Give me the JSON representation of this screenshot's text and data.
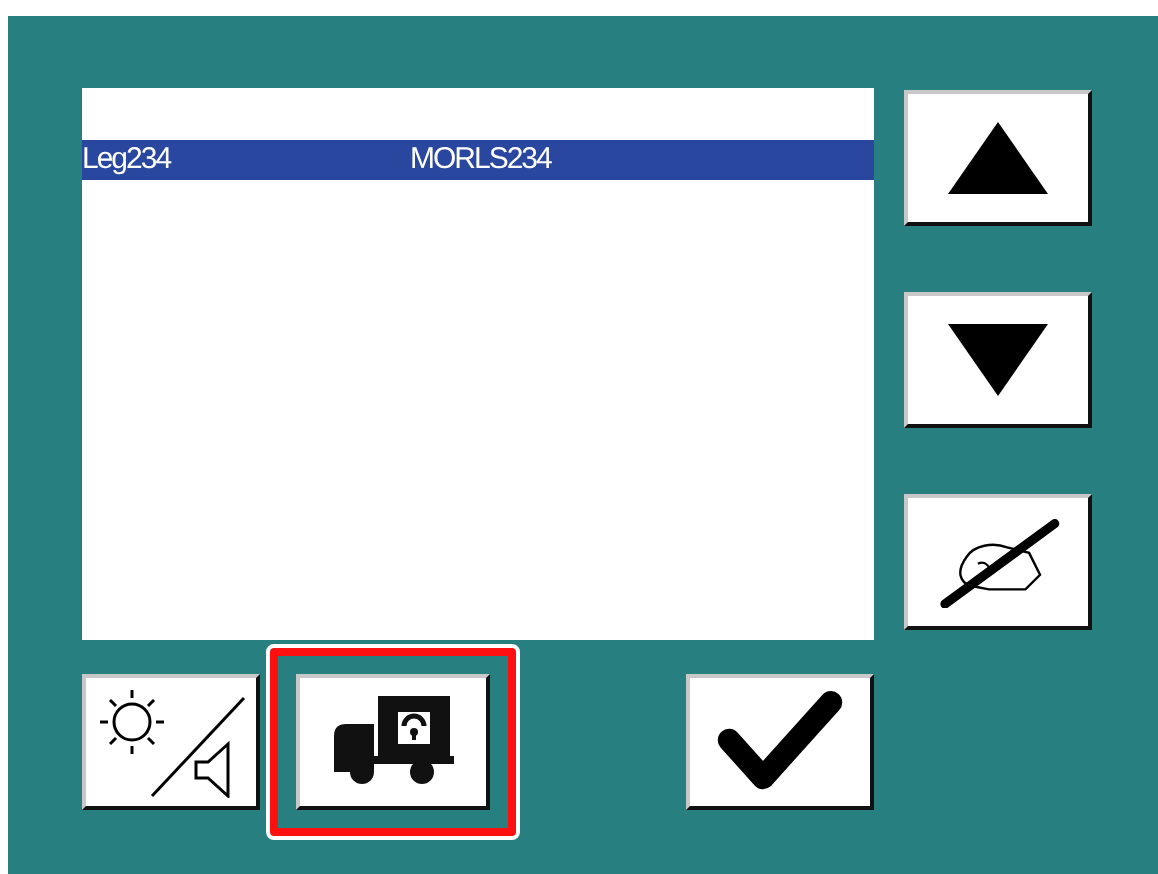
{
  "list": {
    "rows": [
      {
        "cells": [
          "",
          ""
        ],
        "selected": false
      },
      {
        "cells": [
          "Leg234",
          "MORLS234"
        ],
        "selected": true
      }
    ]
  },
  "side_buttons": [
    {
      "kind": "up"
    },
    {
      "kind": "down"
    },
    {
      "kind": "sign"
    }
  ],
  "bottom_buttons": [
    {
      "kind": "brightness-volume",
      "highlighted": false
    },
    {
      "kind": "truck-lock",
      "highlighted": true
    },
    {
      "kind": "confirm",
      "highlighted": false
    }
  ]
}
